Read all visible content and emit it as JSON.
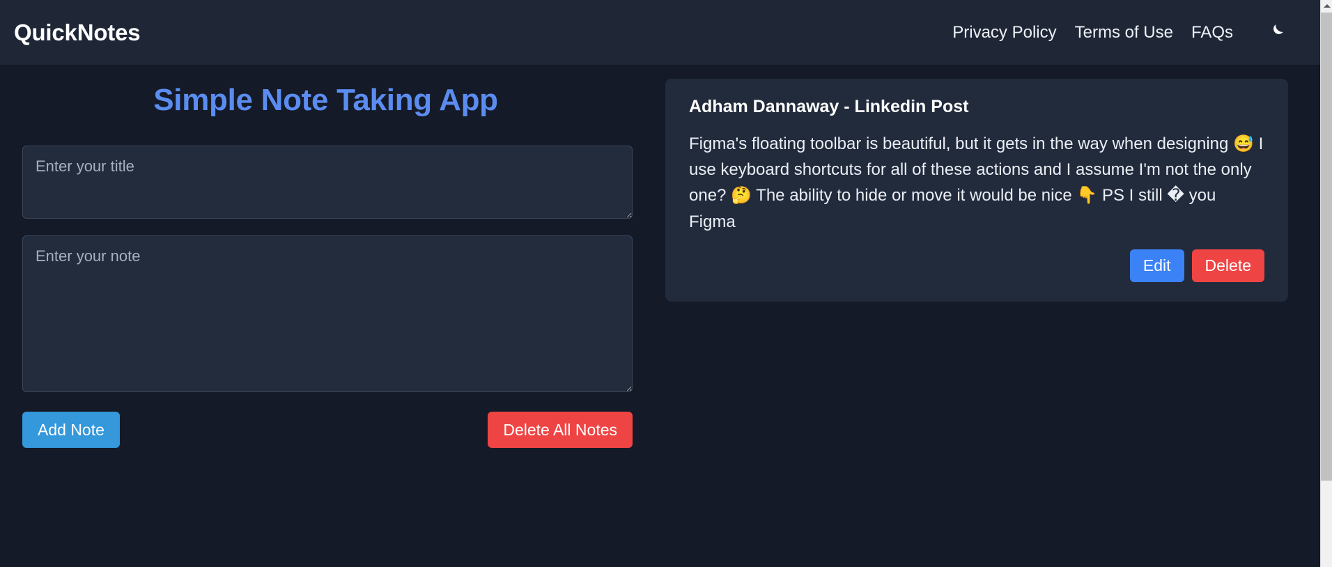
{
  "header": {
    "brand": "QuickNotes",
    "nav": [
      {
        "label": "Privacy Policy",
        "name": "nav-privacy-policy"
      },
      {
        "label": "Terms of Use",
        "name": "nav-terms-of-use"
      },
      {
        "label": "FAQs",
        "name": "nav-faqs"
      }
    ],
    "theme_toggle_icon": "moon-icon",
    "bg_color": "#1f2737"
  },
  "main": {
    "page_title": "Simple Note Taking App",
    "page_title_color": "#5b8cf0",
    "title_input": {
      "value": "",
      "placeholder": "Enter your title"
    },
    "note_input": {
      "value": "",
      "placeholder": "Enter your note"
    },
    "add_note_label": "Add Note",
    "add_note_color": "#3498db",
    "delete_all_label": "Delete All Notes",
    "delete_all_color": "#ef4444"
  },
  "notes": [
    {
      "title": "Adham Dannaway - Linkedin Post",
      "body": "Figma's floating toolbar is beautiful, but it gets in the way when designing 😅 I use keyboard shortcuts for all of these actions and I assume I'm not the only one? 🤔 The ability to hide or move it would be nice 👇 PS I still � you Figma",
      "edit_label": "Edit",
      "delete_label": "Delete",
      "edit_color": "#3b82f6",
      "delete_color": "#ef4444"
    }
  ],
  "scrollbar": {
    "position": "right",
    "thumb_color": "#c1c1c1",
    "track_color": "#f1f1f1"
  },
  "page_bg": "#141a27"
}
